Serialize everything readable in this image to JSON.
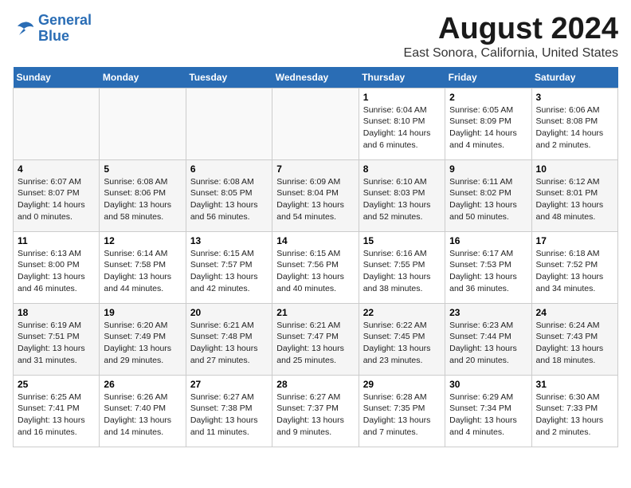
{
  "header": {
    "logo_line1": "General",
    "logo_line2": "Blue",
    "main_title": "August 2024",
    "subtitle": "East Sonora, California, United States"
  },
  "days_of_week": [
    "Sunday",
    "Monday",
    "Tuesday",
    "Wednesday",
    "Thursday",
    "Friday",
    "Saturday"
  ],
  "weeks": [
    [
      {
        "num": "",
        "info": ""
      },
      {
        "num": "",
        "info": ""
      },
      {
        "num": "",
        "info": ""
      },
      {
        "num": "",
        "info": ""
      },
      {
        "num": "1",
        "info": "Sunrise: 6:04 AM\nSunset: 8:10 PM\nDaylight: 14 hours\nand 6 minutes."
      },
      {
        "num": "2",
        "info": "Sunrise: 6:05 AM\nSunset: 8:09 PM\nDaylight: 14 hours\nand 4 minutes."
      },
      {
        "num": "3",
        "info": "Sunrise: 6:06 AM\nSunset: 8:08 PM\nDaylight: 14 hours\nand 2 minutes."
      }
    ],
    [
      {
        "num": "4",
        "info": "Sunrise: 6:07 AM\nSunset: 8:07 PM\nDaylight: 14 hours\nand 0 minutes."
      },
      {
        "num": "5",
        "info": "Sunrise: 6:08 AM\nSunset: 8:06 PM\nDaylight: 13 hours\nand 58 minutes."
      },
      {
        "num": "6",
        "info": "Sunrise: 6:08 AM\nSunset: 8:05 PM\nDaylight: 13 hours\nand 56 minutes."
      },
      {
        "num": "7",
        "info": "Sunrise: 6:09 AM\nSunset: 8:04 PM\nDaylight: 13 hours\nand 54 minutes."
      },
      {
        "num": "8",
        "info": "Sunrise: 6:10 AM\nSunset: 8:03 PM\nDaylight: 13 hours\nand 52 minutes."
      },
      {
        "num": "9",
        "info": "Sunrise: 6:11 AM\nSunset: 8:02 PM\nDaylight: 13 hours\nand 50 minutes."
      },
      {
        "num": "10",
        "info": "Sunrise: 6:12 AM\nSunset: 8:01 PM\nDaylight: 13 hours\nand 48 minutes."
      }
    ],
    [
      {
        "num": "11",
        "info": "Sunrise: 6:13 AM\nSunset: 8:00 PM\nDaylight: 13 hours\nand 46 minutes."
      },
      {
        "num": "12",
        "info": "Sunrise: 6:14 AM\nSunset: 7:58 PM\nDaylight: 13 hours\nand 44 minutes."
      },
      {
        "num": "13",
        "info": "Sunrise: 6:15 AM\nSunset: 7:57 PM\nDaylight: 13 hours\nand 42 minutes."
      },
      {
        "num": "14",
        "info": "Sunrise: 6:15 AM\nSunset: 7:56 PM\nDaylight: 13 hours\nand 40 minutes."
      },
      {
        "num": "15",
        "info": "Sunrise: 6:16 AM\nSunset: 7:55 PM\nDaylight: 13 hours\nand 38 minutes."
      },
      {
        "num": "16",
        "info": "Sunrise: 6:17 AM\nSunset: 7:53 PM\nDaylight: 13 hours\nand 36 minutes."
      },
      {
        "num": "17",
        "info": "Sunrise: 6:18 AM\nSunset: 7:52 PM\nDaylight: 13 hours\nand 34 minutes."
      }
    ],
    [
      {
        "num": "18",
        "info": "Sunrise: 6:19 AM\nSunset: 7:51 PM\nDaylight: 13 hours\nand 31 minutes."
      },
      {
        "num": "19",
        "info": "Sunrise: 6:20 AM\nSunset: 7:49 PM\nDaylight: 13 hours\nand 29 minutes."
      },
      {
        "num": "20",
        "info": "Sunrise: 6:21 AM\nSunset: 7:48 PM\nDaylight: 13 hours\nand 27 minutes."
      },
      {
        "num": "21",
        "info": "Sunrise: 6:21 AM\nSunset: 7:47 PM\nDaylight: 13 hours\nand 25 minutes."
      },
      {
        "num": "22",
        "info": "Sunrise: 6:22 AM\nSunset: 7:45 PM\nDaylight: 13 hours\nand 23 minutes."
      },
      {
        "num": "23",
        "info": "Sunrise: 6:23 AM\nSunset: 7:44 PM\nDaylight: 13 hours\nand 20 minutes."
      },
      {
        "num": "24",
        "info": "Sunrise: 6:24 AM\nSunset: 7:43 PM\nDaylight: 13 hours\nand 18 minutes."
      }
    ],
    [
      {
        "num": "25",
        "info": "Sunrise: 6:25 AM\nSunset: 7:41 PM\nDaylight: 13 hours\nand 16 minutes."
      },
      {
        "num": "26",
        "info": "Sunrise: 6:26 AM\nSunset: 7:40 PM\nDaylight: 13 hours\nand 14 minutes."
      },
      {
        "num": "27",
        "info": "Sunrise: 6:27 AM\nSunset: 7:38 PM\nDaylight: 13 hours\nand 11 minutes."
      },
      {
        "num": "28",
        "info": "Sunrise: 6:27 AM\nSunset: 7:37 PM\nDaylight: 13 hours\nand 9 minutes."
      },
      {
        "num": "29",
        "info": "Sunrise: 6:28 AM\nSunset: 7:35 PM\nDaylight: 13 hours\nand 7 minutes."
      },
      {
        "num": "30",
        "info": "Sunrise: 6:29 AM\nSunset: 7:34 PM\nDaylight: 13 hours\nand 4 minutes."
      },
      {
        "num": "31",
        "info": "Sunrise: 6:30 AM\nSunset: 7:33 PM\nDaylight: 13 hours\nand 2 minutes."
      }
    ]
  ]
}
